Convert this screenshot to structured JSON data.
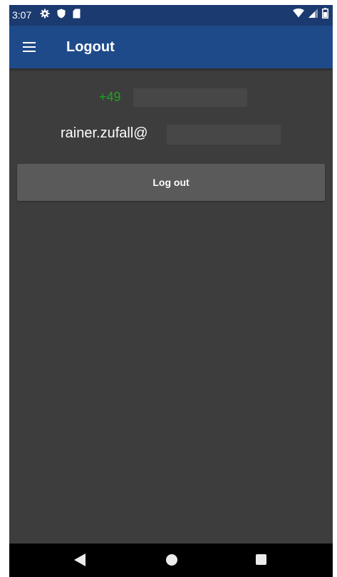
{
  "status_bar": {
    "time": "3:07",
    "icons_left": [
      "gear-icon",
      "shield-icon",
      "sd-card-icon"
    ],
    "icons_right": [
      "wifi-icon",
      "cell-signal-icon",
      "battery-icon"
    ]
  },
  "app_bar": {
    "menu_icon": "hamburger-menu-icon",
    "title": "Logout"
  },
  "account": {
    "phone_prefix": "+49",
    "email_prefix": "rainer.zufall@"
  },
  "logout_button": {
    "label": "Log out"
  },
  "nav_bar": {
    "icons": [
      "back-icon",
      "home-icon",
      "recents-icon"
    ]
  },
  "colors": {
    "status_bar": "#1b3a70",
    "app_bar": "#1f4a8a",
    "background": "#3d3d3d",
    "phone_text": "#1fa31f",
    "button": "#5a5a5a",
    "nav_bar": "#000000"
  }
}
